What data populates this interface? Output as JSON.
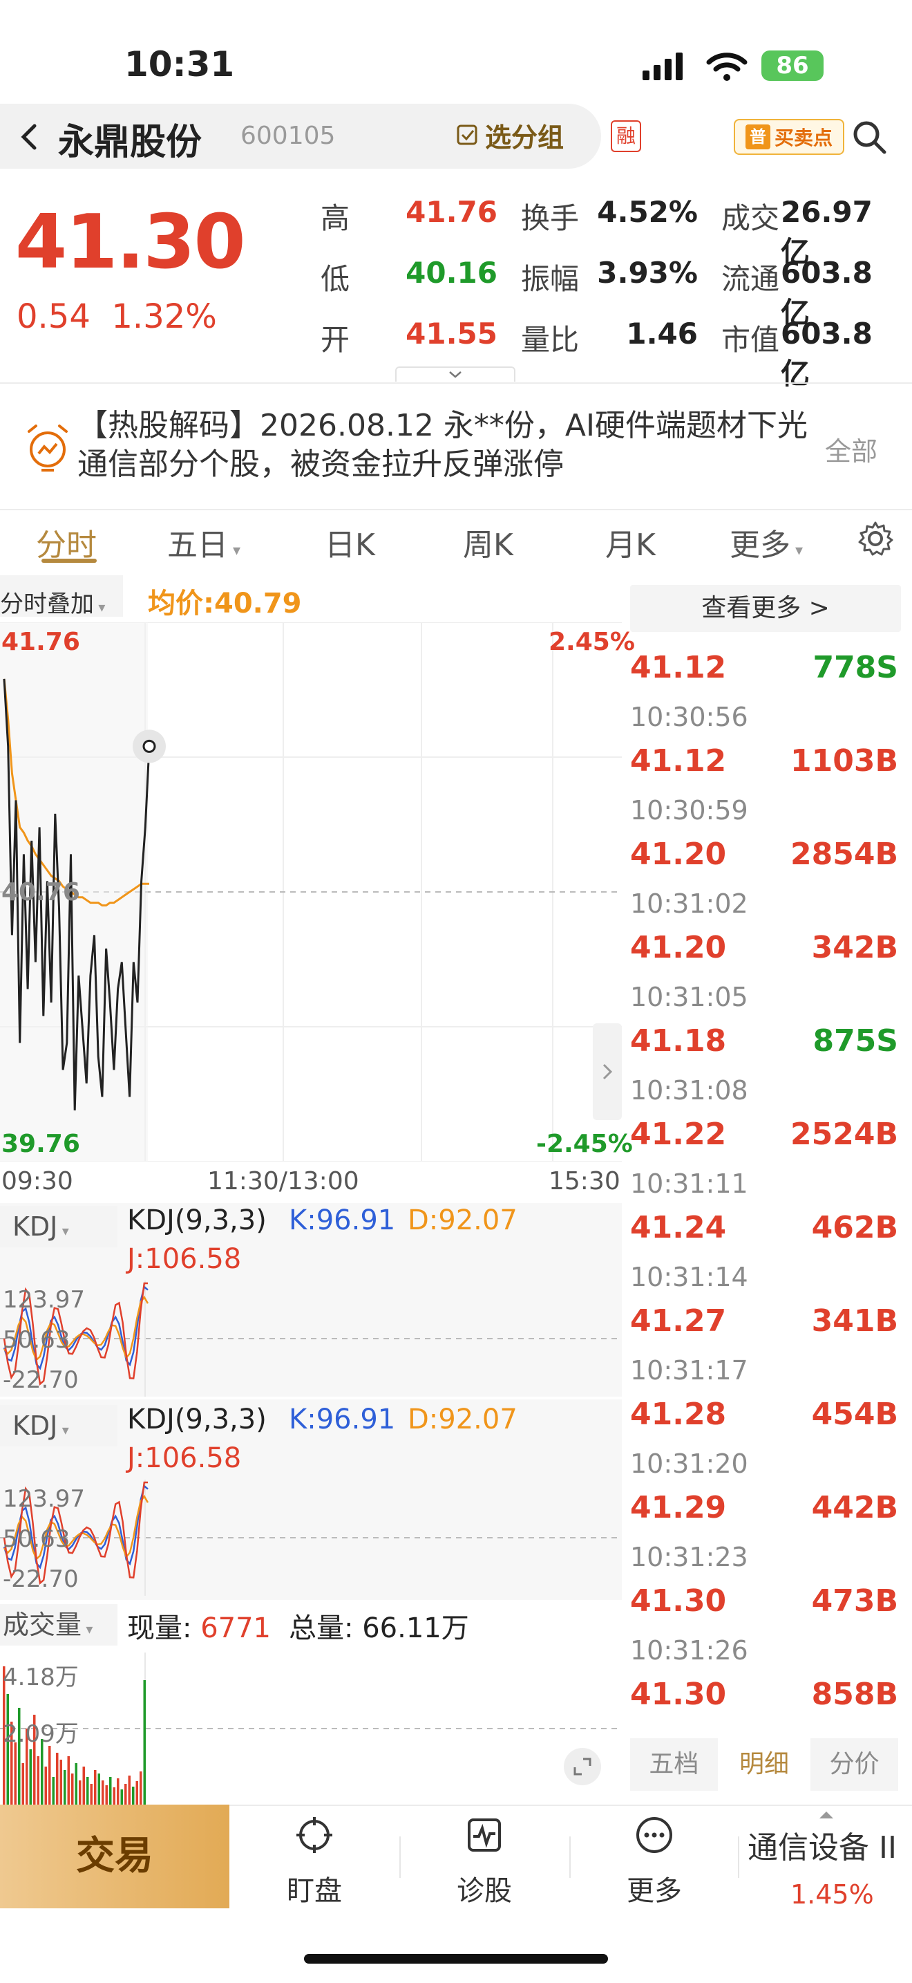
{
  "status_bar": {
    "time": "10:31",
    "battery": "86"
  },
  "header": {
    "stock_name": "永鼎股份",
    "stock_code": "600105",
    "watchlist_label": "选分组",
    "margin_badge": "融",
    "buysell_prefix": "普",
    "buysell_label": "买卖点"
  },
  "quote": {
    "price": "41.30",
    "change": "0.54",
    "change_pct": "1.32%",
    "stats": [
      {
        "label": "高",
        "value": "41.76",
        "label2": "换手",
        "value2": "4.52%",
        "label3": "成交",
        "value3": "26.97亿"
      },
      {
        "label": "低",
        "value": "40.16",
        "label2": "振幅",
        "value2": "3.93%",
        "label3": "流通",
        "value3": "603.8亿"
      },
      {
        "label": "开",
        "value": "41.55",
        "label2": "量比",
        "value2": "1.46",
        "label3": "市值",
        "value3": "603.8亿"
      }
    ]
  },
  "news": {
    "text": "【热股解码】2026.08.12 永**份，AI硬件端题材下光通信部分个股，被资金拉升反弹涨停",
    "all_label": "全部"
  },
  "tabs": [
    "分时",
    "五日",
    "日K",
    "周K",
    "月K",
    "更多"
  ],
  "intraday": {
    "overlay_label": "分时叠加",
    "avg_price_label": "均价:40.79",
    "high": "41.76",
    "high_pct": "2.45%",
    "mid": "40.76",
    "low": "39.76",
    "low_pct": "-2.45%",
    "time_start": "09:30",
    "time_mid": "11:30/13:00",
    "time_end": "15:30"
  },
  "kdj": [
    {
      "chip": "KDJ",
      "params": "KDJ(9,3,3)",
      "k": "K:96.91",
      "d": "D:92.07",
      "j": "J:106.58",
      "axis_top": "123.97",
      "axis_mid": "50.63",
      "axis_low": "-22.70"
    },
    {
      "chip": "KDJ",
      "params": "KDJ(9,3,3)",
      "k": "K:96.91",
      "d": "D:92.07",
      "j": "J:106.58",
      "axis_top": "123.97",
      "axis_mid": "50.63",
      "axis_low": "-22.70"
    }
  ],
  "volume": {
    "chip": "成交量",
    "current_label": "现量:",
    "current_value": "6771",
    "total_label": "总量:",
    "total_value": "66.11万",
    "axis_top": "4.18万",
    "axis_mid": "2.09万"
  },
  "tape": {
    "more_label": "查看更多 >",
    "rows": [
      {
        "time": "",
        "price": "41.12",
        "vol": "778S",
        "side": "S"
      },
      {
        "time": "10:30:56",
        "price": "41.12",
        "vol": "1103B",
        "side": "B"
      },
      {
        "time": "10:30:59",
        "price": "41.20",
        "vol": "2854B",
        "side": "B"
      },
      {
        "time": "10:31:02",
        "price": "41.20",
        "vol": "342B",
        "side": "B"
      },
      {
        "time": "10:31:05",
        "price": "41.18",
        "vol": "875S",
        "side": "S"
      },
      {
        "time": "10:31:08",
        "price": "41.22",
        "vol": "2524B",
        "side": "B"
      },
      {
        "time": "10:31:11",
        "price": "41.24",
        "vol": "462B",
        "side": "B"
      },
      {
        "time": "10:31:14",
        "price": "41.27",
        "vol": "341B",
        "side": "B"
      },
      {
        "time": "10:31:17",
        "price": "41.28",
        "vol": "454B",
        "side": "B"
      },
      {
        "time": "10:31:20",
        "price": "41.29",
        "vol": "442B",
        "side": "B"
      },
      {
        "time": "10:31:23",
        "price": "41.30",
        "vol": "473B",
        "side": "B"
      },
      {
        "time": "10:31:26",
        "price": "41.30",
        "vol": "858B",
        "side": "B"
      }
    ],
    "tabs": [
      "五档",
      "明细",
      "分价"
    ]
  },
  "bottom_bar": {
    "trade": "交易",
    "items": [
      "盯盘",
      "诊股",
      "更多"
    ],
    "sector_name": "通信设备 II",
    "sector_change": "1.45%"
  },
  "colors": {
    "up": "#e0402c",
    "down": "#1f9a2a",
    "avg": "#f0951a",
    "accent": "#b5893e"
  },
  "chart_data": {
    "type": "line",
    "title": "",
    "ylim": [
      39.76,
      41.76
    ],
    "series": [
      {
        "name": "",
        "values": [
          41.55,
          41.3,
          40.6,
          41.1,
          40.2,
          40.9,
          40.4,
          40.95,
          40.5,
          41.0,
          40.3,
          40.8,
          40.35,
          41.05,
          40.7,
          40.1,
          40.2,
          40.9,
          39.95,
          40.45,
          40.25,
          40.05,
          40.45,
          40.6,
          40.15,
          40.0,
          40.55,
          40.35,
          40.1,
          40.4,
          40.5,
          40.25,
          40.0,
          40.5,
          40.35,
          40.8,
          41.0,
          41.3
        ]
      },
      {
        "name": "均价",
        "values": [
          41.55,
          41.4,
          41.2,
          41.1,
          41.0,
          40.98,
          40.95,
          40.93,
          40.9,
          40.88,
          40.86,
          40.84,
          40.82,
          40.81,
          40.8,
          40.78,
          40.77,
          40.76,
          40.75,
          40.74,
          40.74,
          40.73,
          40.72,
          40.72,
          40.72,
          40.71,
          40.71,
          40.72,
          40.72,
          40.73,
          40.74,
          40.75,
          40.76,
          40.77,
          40.78,
          40.79,
          40.79,
          40.79
        ]
      }
    ]
  }
}
